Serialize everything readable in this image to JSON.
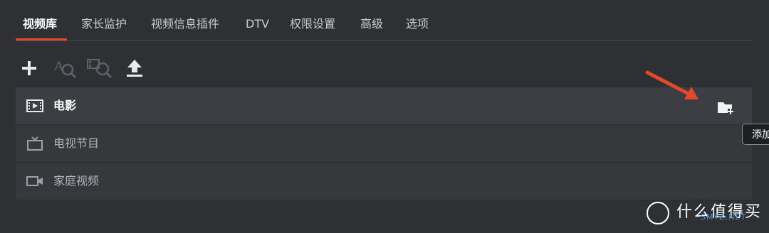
{
  "tabs": [
    {
      "label": "视频库",
      "active": true
    },
    {
      "label": "家长监护"
    },
    {
      "label": "视频信息插件"
    },
    {
      "label": "DTV"
    },
    {
      "label": "权限设置"
    },
    {
      "label": "高级"
    },
    {
      "label": "选项"
    }
  ],
  "toolbar": {
    "icons": [
      "add-icon",
      "text-search-icon",
      "video-search-icon",
      "upload-icon"
    ]
  },
  "libraries": [
    {
      "label": "电影",
      "icon": "film-icon",
      "selected": true
    },
    {
      "label": "电视节目",
      "icon": "tv-icon"
    },
    {
      "label": "家庭视频",
      "icon": "camera-icon"
    }
  ],
  "tooltip": {
    "text": "添加"
  },
  "watermark": {
    "text": "什么值得买",
    "sub": "SMYZ.NET"
  },
  "colors": {
    "accent": "#e5482a",
    "background": "#2e3034"
  }
}
